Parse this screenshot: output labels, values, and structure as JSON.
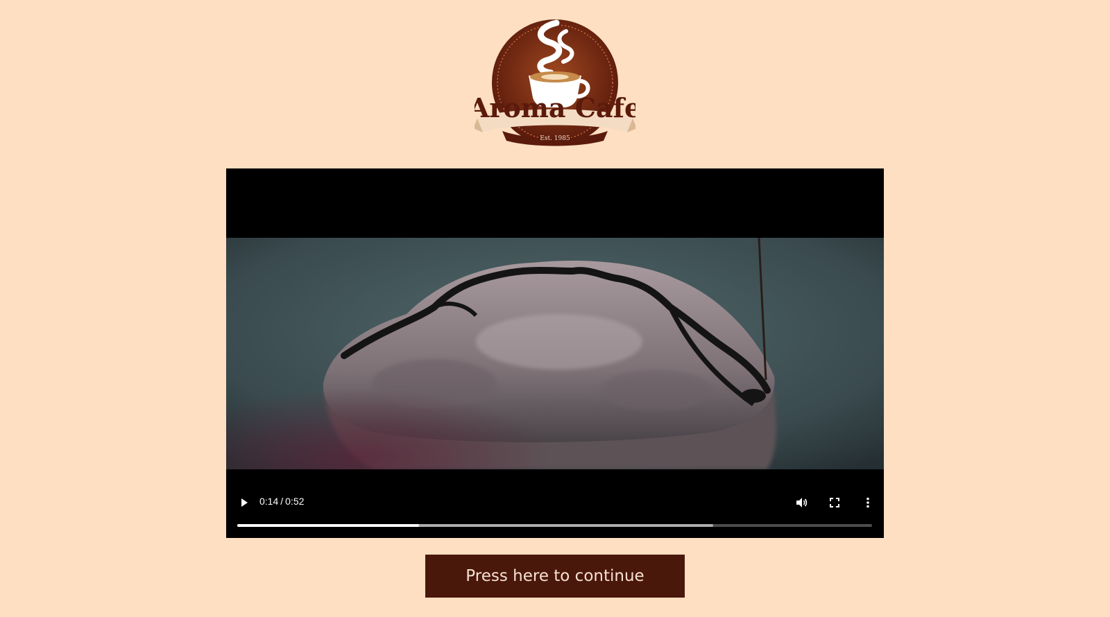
{
  "logo": {
    "brand_name": "Aroma Cafe",
    "established": "Est. 1985",
    "colors": {
      "dark_brown": "#5a1a0c",
      "mid_brown": "#8a3a1c",
      "cream": "#f3dcc3"
    }
  },
  "video": {
    "current_time": "0:14",
    "separator": "/",
    "duration": "0:52",
    "played_fraction": 0.286,
    "buffered_fraction": 0.75,
    "icons": {
      "play": "play-icon",
      "volume": "volume-icon",
      "fullscreen": "fullscreen-icon",
      "more": "more-options-icon"
    }
  },
  "continue_button": {
    "label": "Press here to continue"
  },
  "colors": {
    "page_background": "#ffdfc1",
    "button_background": "#4a170b",
    "button_text": "#f6e2d2"
  }
}
